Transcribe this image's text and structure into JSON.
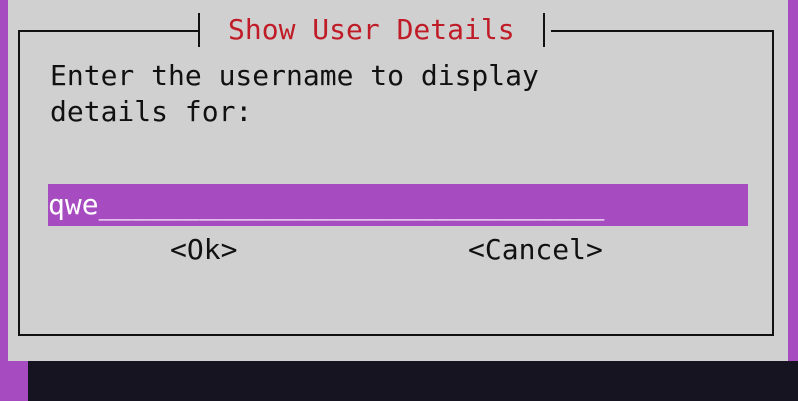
{
  "dialog": {
    "title": "Show User Details",
    "prompt_line1": "Enter the username to display",
    "prompt_line2": "details for:",
    "username_value": "qwe",
    "username_fill": "______________________________",
    "ok_label": "<Ok>",
    "cancel_label": "<Cancel>"
  },
  "colors": {
    "background_accent": "#a64bc0",
    "dialog_background": "#d0d0d0",
    "title_color": "#c01c28",
    "terminal_background": "#171421"
  }
}
